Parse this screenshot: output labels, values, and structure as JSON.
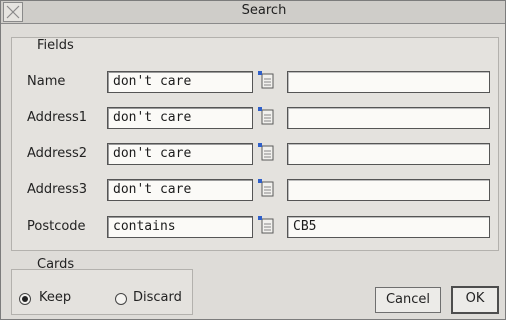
{
  "window": {
    "title": "Search"
  },
  "fields_group": {
    "title": "Fields",
    "rows": [
      {
        "label": "Name",
        "condition": "don't care",
        "value": ""
      },
      {
        "label": "Address1",
        "condition": "don't care",
        "value": ""
      },
      {
        "label": "Address2",
        "condition": "don't care",
        "value": ""
      },
      {
        "label": "Address3",
        "condition": "don't care",
        "value": ""
      },
      {
        "label": "Postcode",
        "condition": "contains",
        "value": "CB5"
      }
    ]
  },
  "cards_group": {
    "title": "Cards",
    "options": [
      {
        "label": "Keep",
        "selected": true
      },
      {
        "label": "Discard",
        "selected": false
      }
    ]
  },
  "buttons": {
    "cancel": "Cancel",
    "ok": "OK"
  },
  "icons": {
    "close": "close-icon",
    "menu": "menu-popup-icon"
  },
  "colors": {
    "field_bg": "#fbfaf7",
    "window_bg": "#dedcd8"
  }
}
